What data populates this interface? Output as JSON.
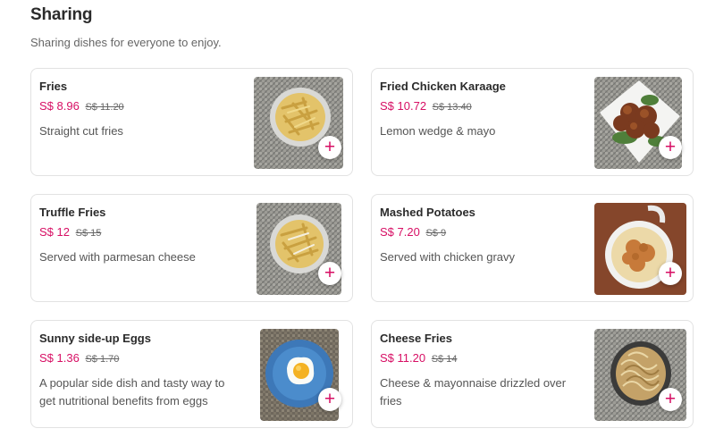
{
  "section": {
    "title": "Sharing",
    "subtitle": "Sharing dishes for everyone to enjoy."
  },
  "add_icon": "plus-icon",
  "accent_color": "#d70f64",
  "items": [
    {
      "name": "Fries",
      "price": "S$ 8.96",
      "old_price": "S$ 11.20",
      "description": "Straight cut fries",
      "image": "fries-photo"
    },
    {
      "name": "Fried Chicken Karaage",
      "price": "S$ 10.72",
      "old_price": "S$ 13.40",
      "description": "Lemon wedge & mayo",
      "image": "karaage-photo"
    },
    {
      "name": "Truffle Fries",
      "price": "S$ 12",
      "old_price": "S$ 15",
      "description": "Served with parmesan cheese",
      "image": "truffle-fries-photo"
    },
    {
      "name": "Mashed Potatoes",
      "price": "S$ 7.20",
      "old_price": "S$ 9",
      "description": "Served with chicken gravy",
      "image": "mashed-potatoes-photo"
    },
    {
      "name": "Sunny side-up Eggs",
      "price": "S$ 1.36",
      "old_price": "S$ 1.70",
      "description": "A popular side dish and tasty way to get nutritional benefits from eggs",
      "image": "eggs-photo"
    },
    {
      "name": "Cheese Fries",
      "price": "S$ 11.20",
      "old_price": "S$ 14",
      "description": "Cheese & mayonnaise drizzled over fries",
      "image": "cheese-fries-photo"
    }
  ]
}
